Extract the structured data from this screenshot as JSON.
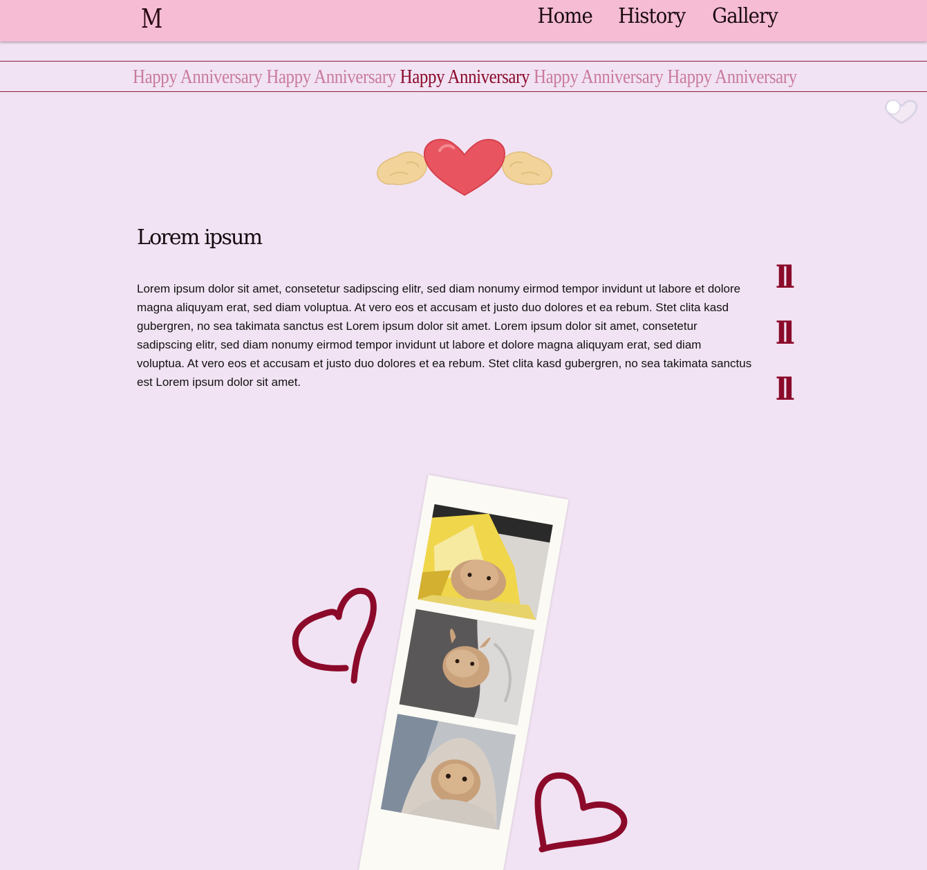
{
  "header": {
    "logo_text": "M",
    "nav": [
      {
        "label": "Home"
      },
      {
        "label": "History"
      },
      {
        "label": "Gallery"
      }
    ]
  },
  "marquee": {
    "items": [
      {
        "label": "Happy Anniversary",
        "active": false
      },
      {
        "label": "Happy Anniversary",
        "active": false
      },
      {
        "label": "Happy Anniversary",
        "active": true
      },
      {
        "label": "Happy Anniversary",
        "active": false
      },
      {
        "label": "Happy Anniversary",
        "active": false
      }
    ]
  },
  "main": {
    "title": "Lorem ipsum",
    "body": "Lorem ipsum dolor sit amet, consetetur sadipscing elitr, sed diam nonumy eirmod tempor invidunt ut labore et dolore magna aliquyam erat, sed diam voluptua. At vero eos et accusam et justo duo dolores et ea rebum. Stet clita kasd gubergren, no sea takimata sanctus est Lorem ipsum dolor sit amet. Lorem ipsum dolor sit amet, consetetur sadipscing elitr, sed diam nonumy eirmod tempor invidunt ut labore et dolore magna aliquyam erat, sed diam voluptua. At vero eos et accusam et justo duo dolores et ea rebum. Stet clita kasd gubergren, no sea takimata sanctus est Lorem ipsum dolor sit amet.",
    "decorations": [
      {
        "glyph": "ll"
      },
      {
        "glyph": "ll"
      },
      {
        "glyph": "ll"
      }
    ]
  },
  "icons": {
    "toggle": "heart-toggle-icon",
    "winged_heart": "winged-heart-icon",
    "heart_doodle": "heart-doodle-icon"
  },
  "colors": {
    "page_bg": "#f1e3f3",
    "header_bg": "#f5bcd4",
    "accent": "#8b0a2a",
    "marquee_muted": "#c97a9c",
    "strip_bg": "#fbfaf4"
  },
  "gallery": {
    "photos": [
      {
        "alt": "bunny in chip bag"
      },
      {
        "alt": "bunny in blanket"
      },
      {
        "alt": "bunny in hood"
      }
    ]
  }
}
